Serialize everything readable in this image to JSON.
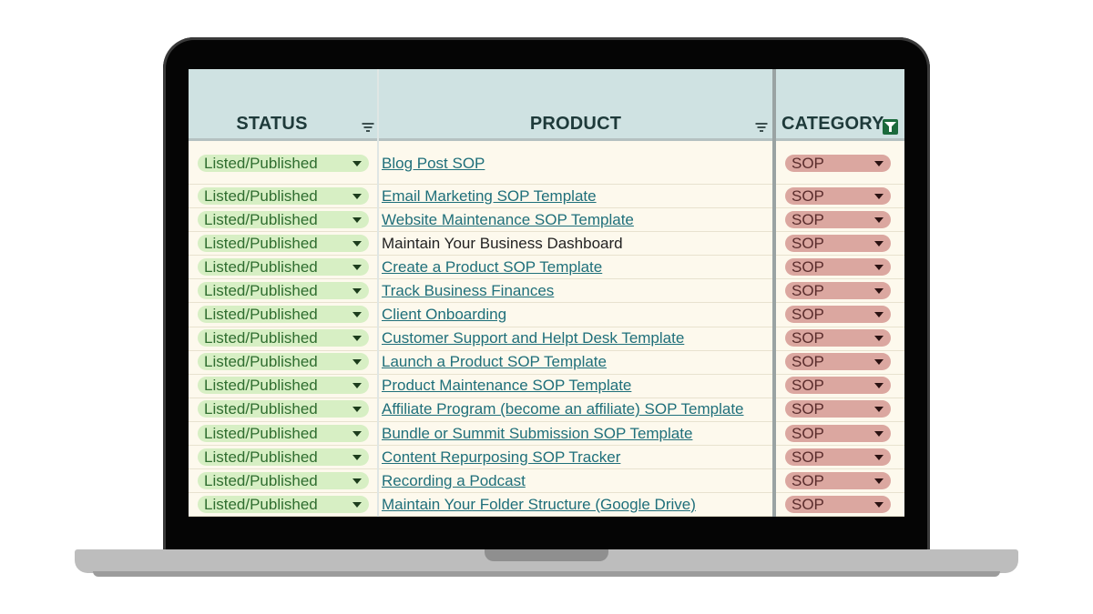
{
  "columns": {
    "status": "STATUS",
    "product": "PRODUCT",
    "category": "CATEGORY"
  },
  "colors": {
    "header_bg": "#cfe2e2",
    "sheet_bg": "#fdf9ed",
    "status_chip": "#d7efc4",
    "category_chip": "#dba7a0",
    "link": "#1f6f7a",
    "active_filter": "#1b6a3c"
  },
  "icons": {
    "status_filter": "filter-lines-icon",
    "product_filter": "filter-lines-icon",
    "category_filter": "active-filter-icon",
    "dropdown": "caret-down-icon"
  },
  "rows": [
    {
      "status": "Listed/Published",
      "product": "Blog Post SOP",
      "linked": true,
      "category": "SOP"
    },
    {
      "status": "Listed/Published",
      "product": "Email Marketing SOP Template",
      "linked": true,
      "category": "SOP"
    },
    {
      "status": "Listed/Published",
      "product": "Website Maintenance SOP Template",
      "linked": true,
      "category": "SOP"
    },
    {
      "status": "Listed/Published",
      "product": "Maintain Your Business Dashboard",
      "linked": false,
      "category": "SOP"
    },
    {
      "status": "Listed/Published",
      "product": "Create a Product SOP Template",
      "linked": true,
      "category": "SOP"
    },
    {
      "status": "Listed/Published",
      "product": "Track Business Finances",
      "linked": true,
      "category": "SOP"
    },
    {
      "status": "Listed/Published",
      "product": "Client Onboarding",
      "linked": true,
      "category": "SOP"
    },
    {
      "status": "Listed/Published",
      "product": "Customer Support and Helpt Desk Template",
      "linked": true,
      "category": "SOP"
    },
    {
      "status": "Listed/Published",
      "product": "Launch a Product SOP Template",
      "linked": true,
      "category": "SOP"
    },
    {
      "status": "Listed/Published",
      "product": "Product Maintenance SOP Template",
      "linked": true,
      "category": "SOP"
    },
    {
      "status": "Listed/Published",
      "product": "Affiliate Program (become an affiliate) SOP Template",
      "linked": true,
      "category": "SOP"
    },
    {
      "status": "Listed/Published",
      "product": "Bundle or Summit Submission SOP Template",
      "linked": true,
      "category": "SOP"
    },
    {
      "status": "Listed/Published",
      "product": "Content Repurposing SOP Tracker",
      "linked": true,
      "category": "SOP"
    },
    {
      "status": "Listed/Published",
      "product": "Recording a Podcast",
      "linked": true,
      "category": "SOP"
    },
    {
      "status": "Listed/Published",
      "product": "Maintain Your Folder Structure (Google Drive)",
      "linked": true,
      "category": "SOP"
    }
  ]
}
